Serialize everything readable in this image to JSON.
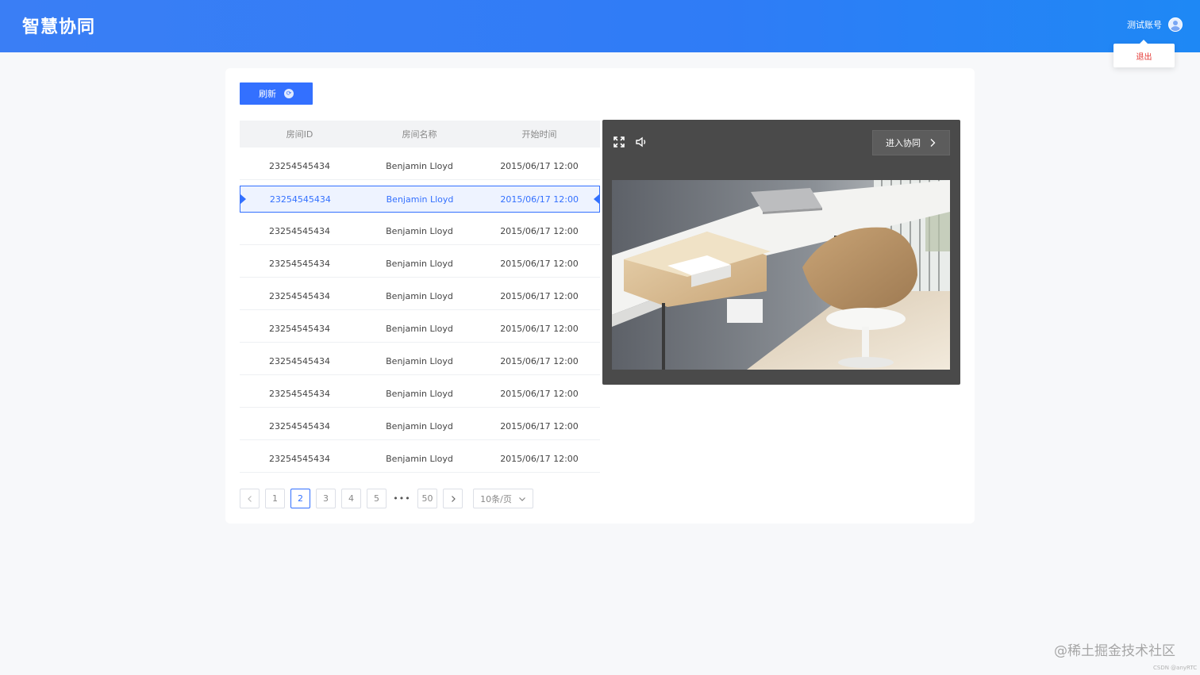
{
  "header": {
    "logo_text": "智慧协同",
    "username": "测试账号",
    "logout_label": "退出"
  },
  "toolbar": {
    "refresh_label": "刷新"
  },
  "table": {
    "columns": [
      "房间ID",
      "房间名称",
      "开始时间"
    ],
    "rows": [
      [
        "23254545434",
        "Benjamin Lloyd",
        "2015/06/17 12:00"
      ],
      [
        "23254545434",
        "Benjamin Lloyd",
        "2015/06/17 12:00"
      ],
      [
        "23254545434",
        "Benjamin Lloyd",
        "2015/06/17 12:00"
      ],
      [
        "23254545434",
        "Benjamin Lloyd",
        "2015/06/17 12:00"
      ],
      [
        "23254545434",
        "Benjamin Lloyd",
        "2015/06/17 12:00"
      ],
      [
        "23254545434",
        "Benjamin Lloyd",
        "2015/06/17 12:00"
      ],
      [
        "23254545434",
        "Benjamin Lloyd",
        "2015/06/17 12:00"
      ],
      [
        "23254545434",
        "Benjamin Lloyd",
        "2015/06/17 12:00"
      ],
      [
        "23254545434",
        "Benjamin Lloyd",
        "2015/06/17 12:00"
      ],
      [
        "23254545434",
        "Benjamin Lloyd",
        "2015/06/17 12:00"
      ]
    ],
    "selected_row": 1
  },
  "pagination": {
    "pages": [
      "1",
      "2",
      "3",
      "4",
      "5"
    ],
    "current": "2",
    "ellipsis": "•••",
    "last": "50",
    "page_size": "10条/页"
  },
  "video": {
    "enter_label": "进入协同"
  },
  "watermark": {
    "main": "@稀土掘金技术社区",
    "small": "CSDN @anyRTC"
  },
  "colors": {
    "primary": "#3370ff",
    "header_gradient_start": "#3a7ef5",
    "header_gradient_end": "#1e88f5",
    "logout": "#e53935",
    "video_bg": "#4a4a4a"
  },
  "icons": [
    "refresh-icon",
    "fullscreen-icon",
    "volume-icon",
    "chevron-right-icon",
    "chevron-left-icon",
    "chevron-down-icon",
    "avatar"
  ]
}
